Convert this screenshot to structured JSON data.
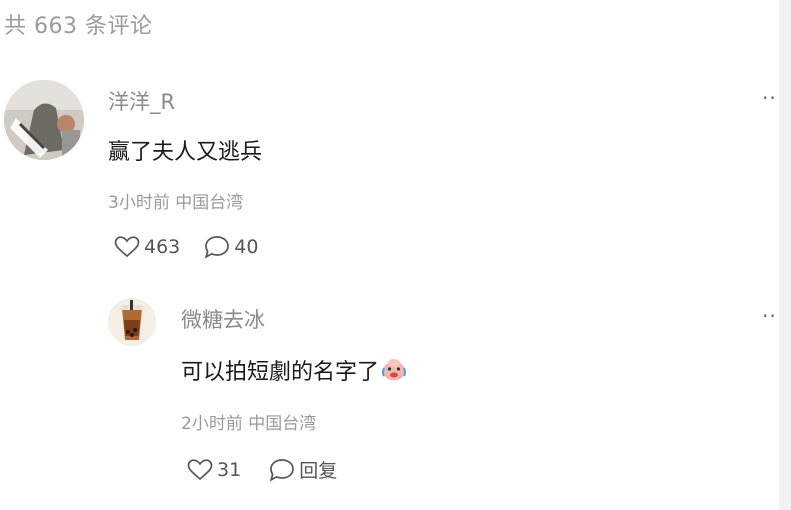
{
  "comments_count_label": "共 663 条评论",
  "comment": {
    "author": "洋洋_R",
    "text": "赢了夫人又逃兵",
    "time_location": "3小时前 中国台湾",
    "likes": "463",
    "replies": "40",
    "more": "··",
    "icons": {
      "like": "heart-outline-icon",
      "reply": "speech-bubble-icon",
      "more": "more-icon"
    }
  },
  "reply": {
    "author": "微糖去冰",
    "text": "可以拍短劇的名字了",
    "emoji": "crying-laughing-face-emoji",
    "time_location": "2小时前 中国台湾",
    "likes": "31",
    "reply_label": "回复",
    "more": "··"
  },
  "colors": {
    "muted": "#9a9aa0",
    "text": "#1a1a1a",
    "scrollbar": "#f2f2f4"
  }
}
